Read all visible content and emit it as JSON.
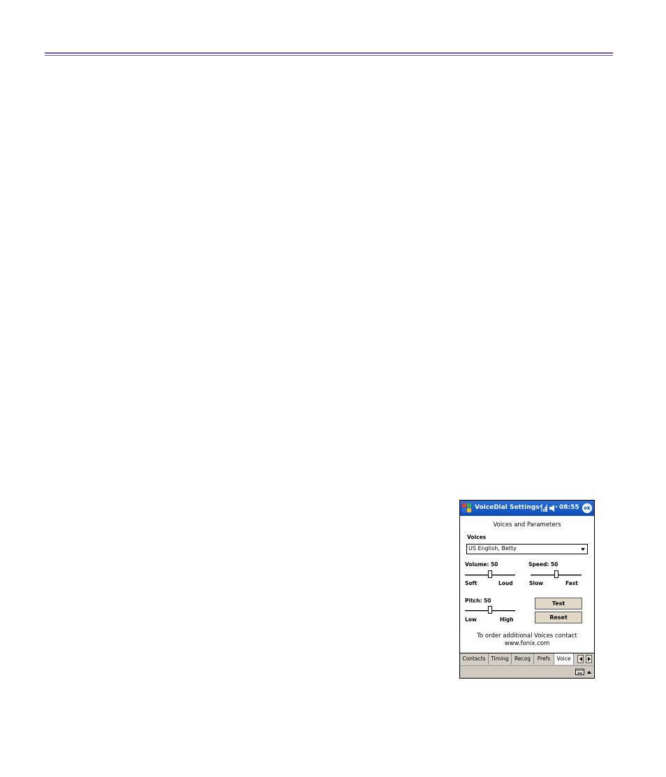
{
  "titlebar": {
    "app_title": "VoiceDial Settings",
    "time": "08:55",
    "ok_label": "ok"
  },
  "screen": {
    "heading": "Voices and Parameters",
    "voices_label": "Voices",
    "voice_selected": "US English, Betty"
  },
  "volume": {
    "label": "Volume: 50",
    "value": 50,
    "min_label": "Soft",
    "max_label": "Loud"
  },
  "speed": {
    "label": "Speed: 50",
    "value": 50,
    "min_label": "Slow",
    "max_label": "Fast"
  },
  "pitch": {
    "label": "Pitch: 50",
    "value": 50,
    "min_label": "Low",
    "max_label": "High"
  },
  "buttons": {
    "test": "Test",
    "reset": "Reset"
  },
  "note": {
    "line1": "To order additional Voices contact",
    "line2": "www.fonix.com"
  },
  "tabs": [
    {
      "label": "Contacts",
      "active": false
    },
    {
      "label": "Timing",
      "active": false
    },
    {
      "label": "Recog",
      "active": false
    },
    {
      "label": "Prefs",
      "active": false
    },
    {
      "label": "Voice",
      "active": true
    }
  ],
  "colors": {
    "rule": "#6a5ab4",
    "titlebar": "#0a4bb8",
    "button_face": "#e3d9c8"
  }
}
